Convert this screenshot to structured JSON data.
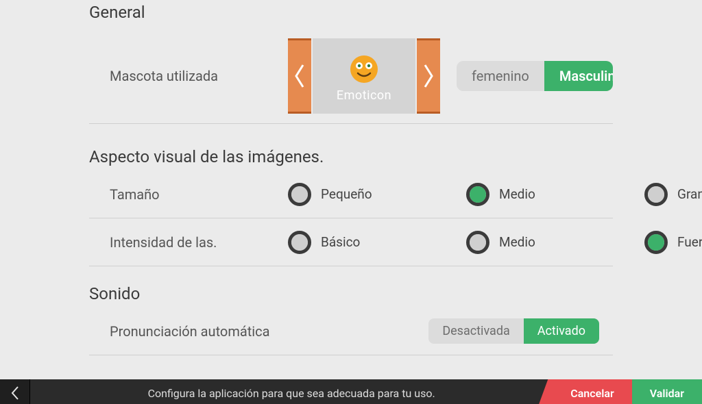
{
  "sections": {
    "general": {
      "title": "General",
      "mascot": {
        "label": "Mascota utilizada",
        "item_caption": "Emoticon",
        "gender_options": {
          "female": "femenino",
          "male": "Masculino"
        },
        "gender_selected": "male"
      }
    },
    "visual": {
      "title": "Aspecto visual de las imágenes.",
      "size": {
        "label": "Tamaño",
        "options": [
          "Pequeño",
          "Medio",
          "Grande"
        ],
        "selected_index": 1
      },
      "intensity": {
        "label": "Intensidad de las.",
        "options": [
          "Básico",
          "Medio",
          "Fuerte"
        ],
        "selected_index": 2
      }
    },
    "sound": {
      "title": "Sonido",
      "auto_pronounce": {
        "label": "Pronunciación automática",
        "options": {
          "off": "Desactivada",
          "on": "Activado"
        },
        "selected": "on"
      }
    }
  },
  "footer": {
    "hint": "Configura la aplicación para que sea adecuada para tu uso.",
    "cancel": "Cancelar",
    "validate": "Validar"
  },
  "colors": {
    "accent_green": "#3cb16a",
    "accent_orange": "#e68a4f",
    "danger": "#e84a4f",
    "bg": "#ebebeb"
  }
}
